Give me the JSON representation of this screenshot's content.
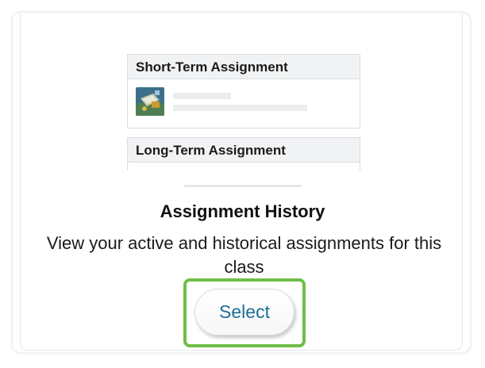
{
  "illustration": {
    "short_term_header": "Short-Term Assignment",
    "long_term_header": "Long-Term Assignment",
    "thumbnail_icon": "assignment-thumbnail-icon"
  },
  "card": {
    "title": "Assignment History",
    "description": "View your active and historical assignments for this class",
    "select_label": "Select"
  },
  "colors": {
    "highlight_outline": "#6fbe48",
    "button_text": "#1b6f95",
    "header_fill": "#f1f2f3"
  }
}
